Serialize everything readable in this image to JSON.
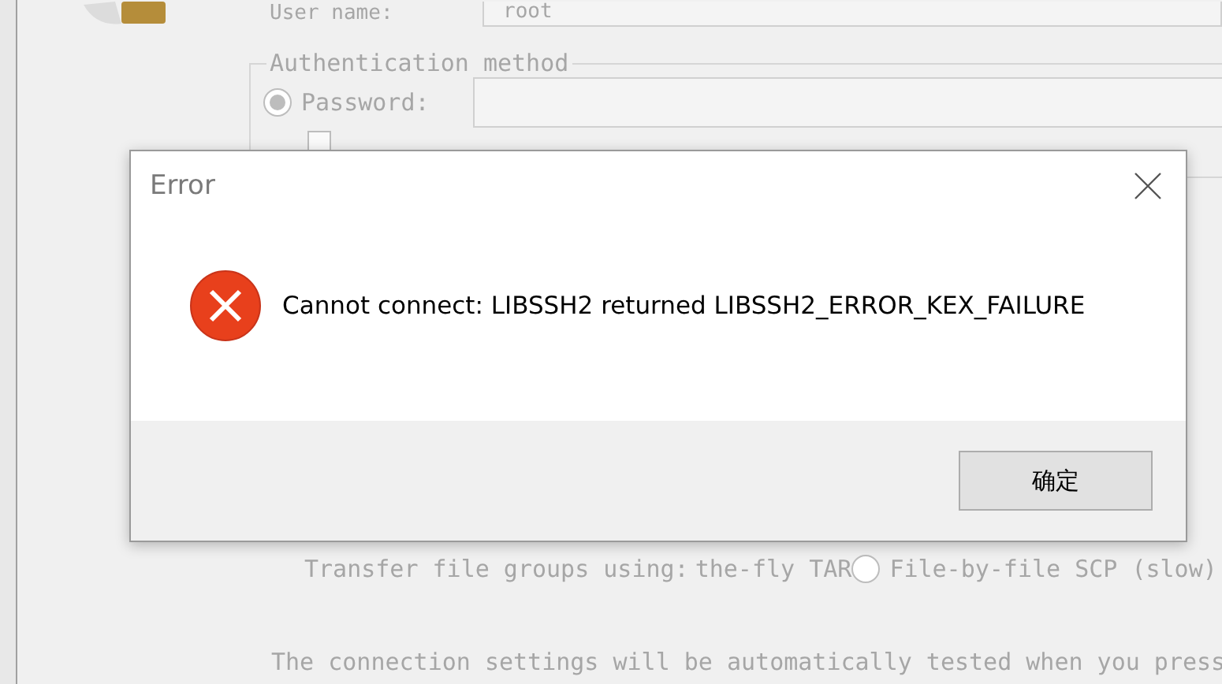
{
  "background_window": {
    "user_name_label": "User name:",
    "user_name_value": "root",
    "auth_group": {
      "legend": "Authentication method",
      "password_option": {
        "label": "Password:",
        "selected": true
      },
      "public_key_checkbox": {
        "checked": false
      }
    },
    "transfer": {
      "label": "Transfer file groups using:",
      "option_a": {
        "label": "the-fly TAR",
        "selected": false
      },
      "option_b": {
        "label": "File-by-file SCP (slow)"
      }
    },
    "note": "The connection settings will be automatically tested when you press"
  },
  "dialog": {
    "title": "Error",
    "message": "Cannot connect: LIBSSH2 returned LIBSSH2_ERROR_KEX_FAILURE",
    "buttons": [
      "确定"
    ]
  }
}
